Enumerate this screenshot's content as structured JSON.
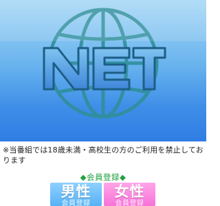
{
  "banner": {
    "logo_text": "NET",
    "colors": {
      "sky_top": "#a7d8f6",
      "sky_bottom": "#2f7de4",
      "globe_stroke": "#2f8f9a"
    },
    "icon": "globe-icon"
  },
  "notice": {
    "text": "※当番組では18歳未満・高校生の方のご利用を禁止しております"
  },
  "member": {
    "title": "◆会員登録◆",
    "male_label": "男性",
    "male_sub": "会員登録",
    "female_label": "女性",
    "female_sub": "会員登録"
  }
}
